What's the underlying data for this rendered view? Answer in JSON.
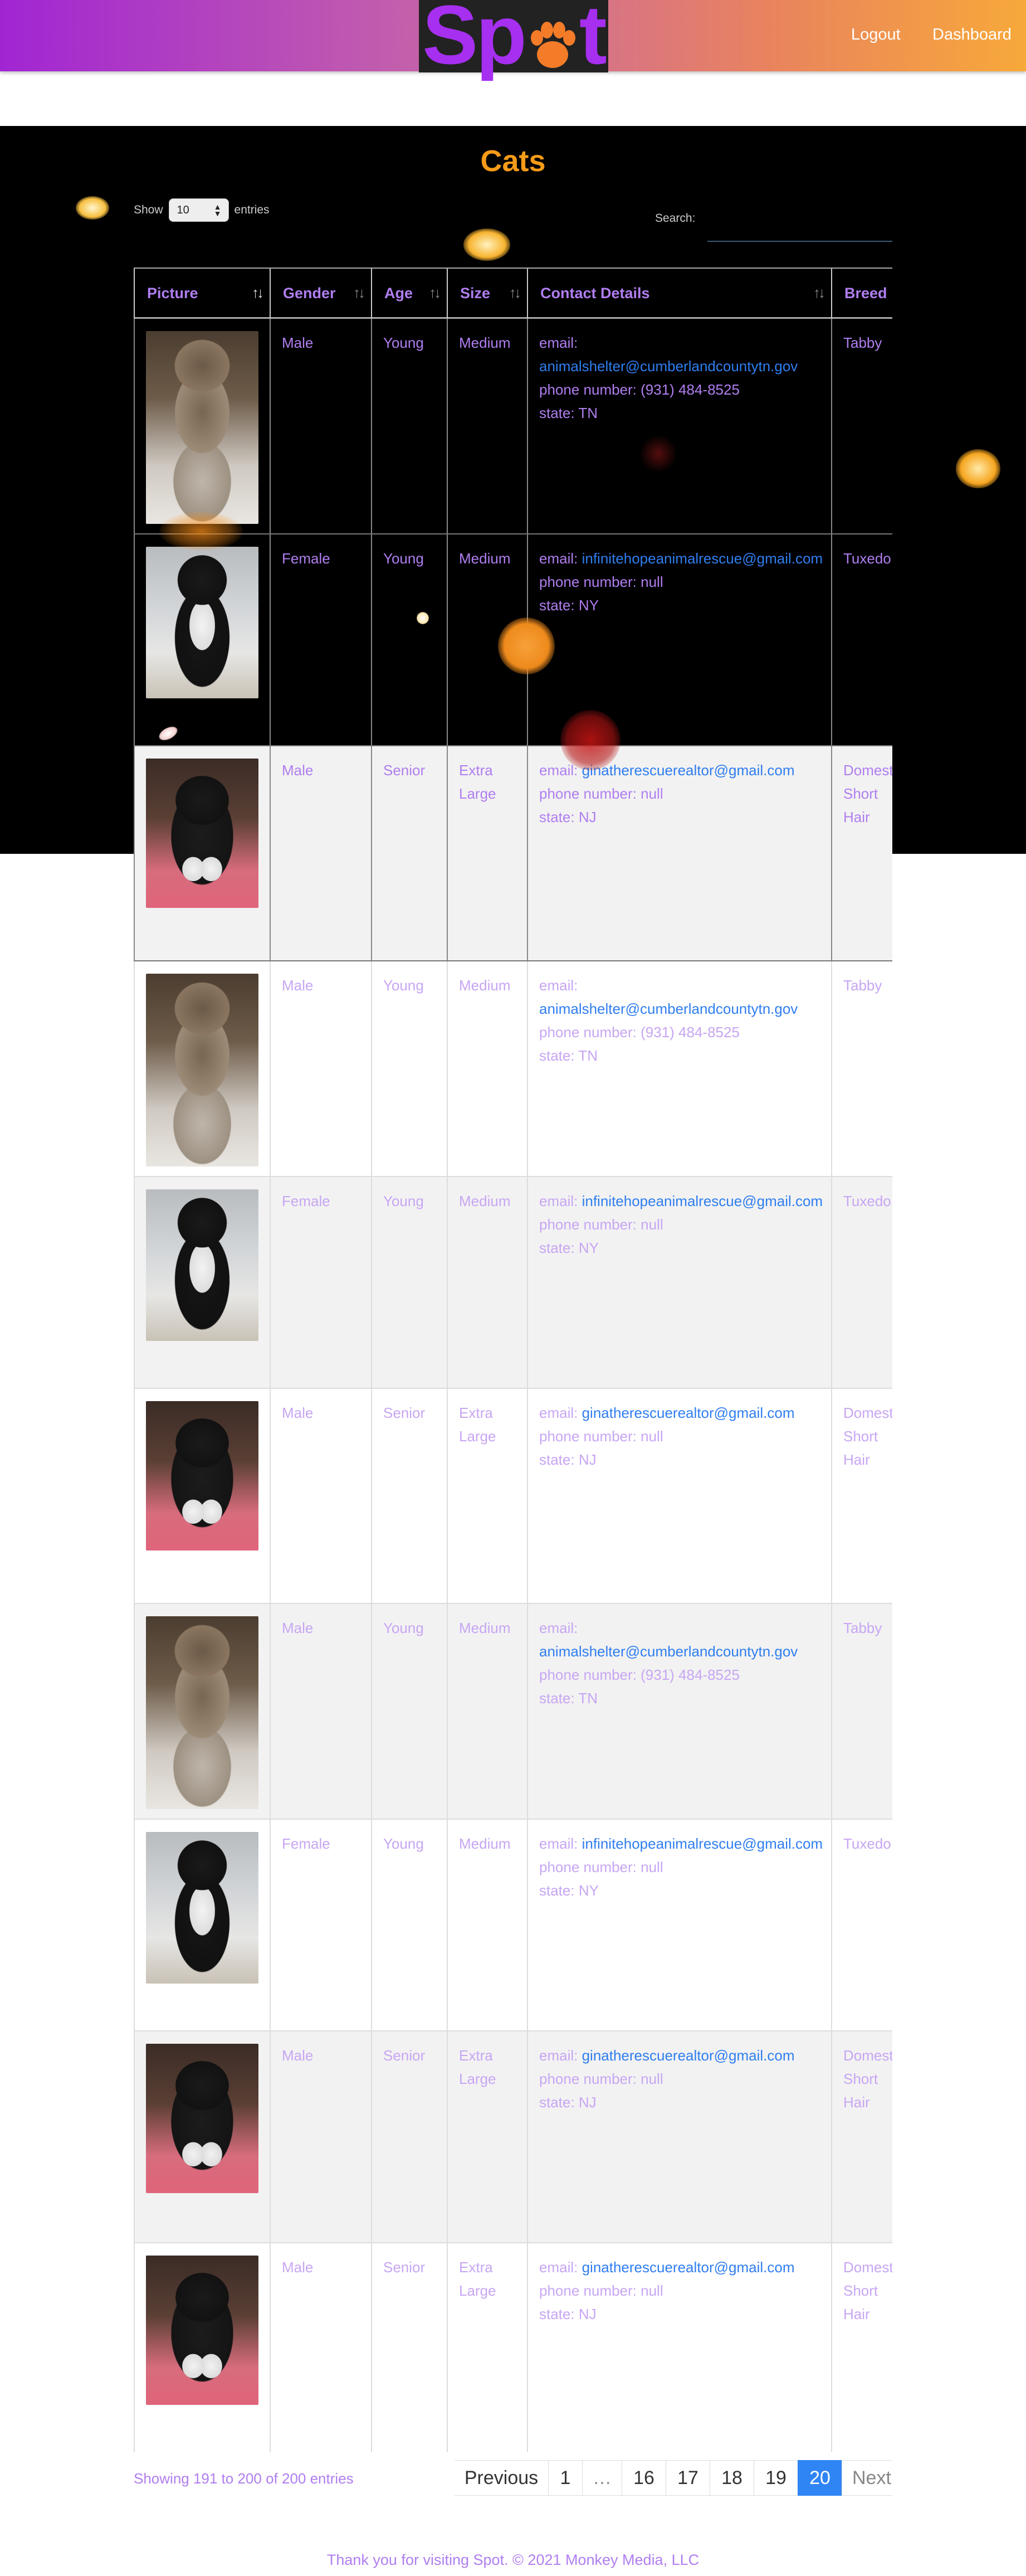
{
  "navbar": {
    "logo": "Spot",
    "links": [
      "Logout",
      "Dashboard"
    ]
  },
  "page": {
    "title": "Cats"
  },
  "controls": {
    "show_label": "Show",
    "entries_value": "10",
    "entries_label": "entries",
    "search_label": "Search:",
    "search_value": ""
  },
  "table": {
    "columns": [
      "Picture",
      "Gender",
      "Age",
      "Size",
      "Contact Details",
      "Breed"
    ],
    "rows": [
      {
        "photo": "tabby-cat-photo",
        "gender": "Male",
        "age": "Young",
        "size": "Medium",
        "email_label": "email:",
        "email": "animalshelter@cumberlandcountytn.gov",
        "phone": "phone number: (931) 484-8525",
        "state": "state: TN",
        "breed": "Tabby"
      },
      {
        "photo": "tuxedo-cat-photo",
        "gender": "Female",
        "age": "Young",
        "size": "Medium",
        "email_label": "email:",
        "email": "infinitehopeanimalrescue@gmail.com",
        "phone": "phone number: null",
        "state": "state: NY",
        "breed": "Tuxedo"
      },
      {
        "photo": "black-white-cat-photo",
        "gender": "Male",
        "age": "Senior",
        "size": "Extra Large",
        "email_label": "email:",
        "email": "ginatherescuerealtor@gmail.com",
        "phone": "phone number: null",
        "state": "state: NJ",
        "breed": "Domestic Short Hair"
      },
      {
        "photo": "tabby-cat-photo",
        "gender": "Male",
        "age": "Young",
        "size": "Medium",
        "email_label": "email:",
        "email": "animalshelter@cumberlandcountytn.gov",
        "phone": "phone number: (931) 484-8525",
        "state": "state: TN",
        "breed": "Tabby"
      },
      {
        "photo": "tuxedo-cat-photo",
        "gender": "Female",
        "age": "Young",
        "size": "Medium",
        "email_label": "email:",
        "email": "infinitehopeanimalrescue@gmail.com",
        "phone": "phone number: null",
        "state": "state: NY",
        "breed": "Tuxedo"
      },
      {
        "photo": "black-white-cat-photo",
        "gender": "Male",
        "age": "Senior",
        "size": "Extra Large",
        "email_label": "email:",
        "email": "ginatherescuerealtor@gmail.com",
        "phone": "phone number: null",
        "state": "state: NJ",
        "breed": "Domestic Short Hair"
      },
      {
        "photo": "tabby-cat-photo",
        "gender": "Male",
        "age": "Young",
        "size": "Medium",
        "email_label": "email:",
        "email": "animalshelter@cumberlandcountytn.gov",
        "phone": "phone number: (931) 484-8525",
        "state": "state: TN",
        "breed": "Tabby"
      },
      {
        "photo": "tuxedo-cat-photo",
        "gender": "Female",
        "age": "Young",
        "size": "Medium",
        "email_label": "email:",
        "email": "infinitehopeanimalrescue@gmail.com",
        "phone": "phone number: null",
        "state": "state: NY",
        "breed": "Tuxedo"
      },
      {
        "photo": "black-white-cat-photo",
        "gender": "Male",
        "age": "Senior",
        "size": "Extra Large",
        "email_label": "email:",
        "email": "ginatherescuerealtor@gmail.com",
        "phone": "phone number: null",
        "state": "state: NJ",
        "breed": "Domestic Short Hair"
      },
      {
        "photo": "black-white-cat-photo",
        "gender": "Male",
        "age": "Senior",
        "size": "Extra Large",
        "email_label": "email:",
        "email": "ginatherescuerealtor@gmail.com",
        "phone": "phone number: null",
        "state": "state: NJ",
        "breed": "Domestic Short Hair"
      }
    ]
  },
  "pagination": {
    "info": "Showing 191 to 200 of 200 entries",
    "previous": "Previous",
    "pages": [
      "1",
      "…",
      "16",
      "17",
      "18",
      "19",
      "20"
    ],
    "active_page": "20",
    "next": "Next"
  },
  "footer": {
    "text": "Thank you for visiting Spot. © 2021 Monkey Media, LLC"
  },
  "colors": {
    "accent_orange": "#f69b18",
    "text_purple": "#b07ef0",
    "link_blue": "#2f7ef0",
    "pager_active": "#2f85f4"
  }
}
